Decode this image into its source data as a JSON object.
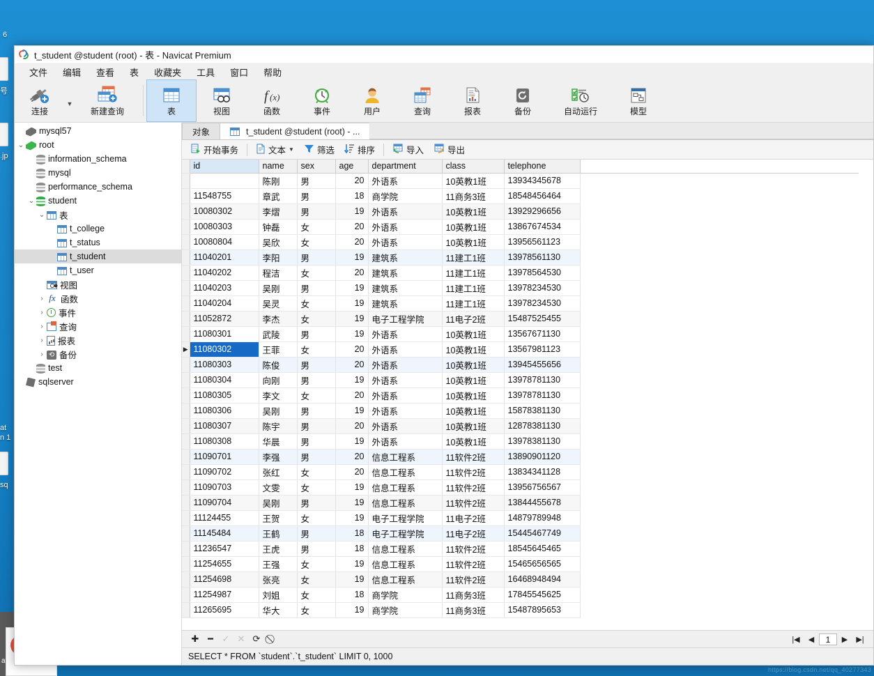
{
  "window": {
    "title": "t_student @student (root) - 表 - Navicat Premium",
    "logo_icon": "navicat-logo-icon"
  },
  "menubar": {
    "items": [
      {
        "label": "文件"
      },
      {
        "label": "编辑"
      },
      {
        "label": "查看"
      },
      {
        "label": "表"
      },
      {
        "label": "收藏夹"
      },
      {
        "label": "工具"
      },
      {
        "label": "窗口"
      },
      {
        "label": "帮助"
      }
    ]
  },
  "ribbon": {
    "items": [
      {
        "label": "连接",
        "icon": "connection-plug-icon",
        "active": false,
        "has_dropdown": true
      },
      {
        "label": "新建查询",
        "icon": "new-query-icon",
        "active": false
      },
      {
        "label": "表",
        "icon": "table-icon",
        "active": true
      },
      {
        "label": "视图",
        "icon": "view-icon",
        "active": false
      },
      {
        "label": "函数",
        "icon": "function-fx-icon",
        "active": false
      },
      {
        "label": "事件",
        "icon": "event-clock-icon",
        "active": false
      },
      {
        "label": "用户",
        "icon": "user-icon",
        "active": false
      },
      {
        "label": "查询",
        "icon": "query-icon",
        "active": false
      },
      {
        "label": "报表",
        "icon": "report-icon",
        "active": false
      },
      {
        "label": "备份",
        "icon": "backup-icon",
        "active": false
      },
      {
        "label": "自动运行",
        "icon": "automation-icon",
        "active": false
      },
      {
        "label": "模型",
        "icon": "model-icon",
        "active": false
      }
    ]
  },
  "sidebar": {
    "items": [
      {
        "label": "mysql57",
        "indent": 0,
        "twist": "",
        "icon": "connection-icon",
        "selected": false
      },
      {
        "label": "root",
        "indent": 0,
        "twist": "v",
        "icon": "connection-green-icon",
        "selected": false
      },
      {
        "label": "information_schema",
        "indent": 1,
        "twist": "",
        "icon": "database-icon",
        "selected": false
      },
      {
        "label": "mysql",
        "indent": 1,
        "twist": "",
        "icon": "database-icon",
        "selected": false
      },
      {
        "label": "performance_schema",
        "indent": 1,
        "twist": "",
        "icon": "database-icon",
        "selected": false
      },
      {
        "label": "student",
        "indent": 1,
        "twist": "v",
        "icon": "database-green-icon",
        "selected": false
      },
      {
        "label": "表",
        "indent": 2,
        "twist": "v",
        "icon": "table-folder-icon",
        "selected": false
      },
      {
        "label": "t_college",
        "indent": 3,
        "twist": "",
        "icon": "table-icon",
        "selected": false
      },
      {
        "label": "t_status",
        "indent": 3,
        "twist": "",
        "icon": "table-icon",
        "selected": false
      },
      {
        "label": "t_student",
        "indent": 3,
        "twist": "",
        "icon": "table-icon",
        "selected": true
      },
      {
        "label": "t_user",
        "indent": 3,
        "twist": "",
        "icon": "table-icon",
        "selected": false
      },
      {
        "label": "视图",
        "indent": 2,
        "twist": "",
        "icon": "view-icon",
        "selected": false
      },
      {
        "label": "函数",
        "indent": 2,
        "twist": ">",
        "icon": "function-fx-icon",
        "selected": false
      },
      {
        "label": "事件",
        "indent": 2,
        "twist": ">",
        "icon": "event-clock-icon",
        "selected": false
      },
      {
        "label": "查询",
        "indent": 2,
        "twist": ">",
        "icon": "query-icon",
        "selected": false
      },
      {
        "label": "报表",
        "indent": 2,
        "twist": ">",
        "icon": "report-icon",
        "selected": false
      },
      {
        "label": "备份",
        "indent": 2,
        "twist": ">",
        "icon": "backup-icon",
        "selected": false
      },
      {
        "label": "test",
        "indent": 1,
        "twist": "",
        "icon": "database-icon",
        "selected": false
      },
      {
        "label": "sqlserver",
        "indent": 0,
        "twist": "",
        "icon": "sqlserver-icon",
        "selected": false
      }
    ]
  },
  "tabs": [
    {
      "label": "对象",
      "active": false,
      "icon": ""
    },
    {
      "label": "t_student @student (root) - ...",
      "active": true,
      "icon": "table-icon"
    }
  ],
  "data_toolbar": {
    "items": [
      {
        "label": "开始事务",
        "icon": "transaction-icon",
        "dropdown": false
      },
      {
        "label": "文本",
        "icon": "text-icon",
        "dropdown": true
      },
      {
        "label": "筛选",
        "icon": "filter-icon",
        "dropdown": false
      },
      {
        "label": "排序",
        "icon": "sort-icon",
        "dropdown": false
      },
      {
        "label": "导入",
        "icon": "import-icon",
        "dropdown": false
      },
      {
        "label": "导出",
        "icon": "export-icon",
        "dropdown": false
      }
    ]
  },
  "grid": {
    "columns": [
      "id",
      "name",
      "sex",
      "age",
      "department",
      "class",
      "telephone"
    ],
    "selected_row_index": 12,
    "rows": [
      [
        "",
        "陈刚",
        "男",
        "20",
        "外语系",
        "10英教1班",
        "13934345678"
      ],
      [
        "11548755",
        "章武",
        "男",
        "18",
        "商学院",
        "11商务3班",
        "18548456464"
      ],
      [
        "10080302",
        "李熠",
        "男",
        "19",
        "外语系",
        "10英教1班",
        "13929296656"
      ],
      [
        "10080303",
        "钟磊",
        "女",
        "20",
        "外语系",
        "10英教1班",
        "13867674534"
      ],
      [
        "10080804",
        "吴欣",
        "女",
        "20",
        "外语系",
        "10英教1班",
        "13956561123"
      ],
      [
        "11040201",
        "李阳",
        "男",
        "19",
        "建筑系",
        "11建工1班",
        "13978561130"
      ],
      [
        "11040202",
        "程洁",
        "女",
        "20",
        "建筑系",
        "11建工1班",
        "13978564530"
      ],
      [
        "11040203",
        "吴刚",
        "男",
        "19",
        "建筑系",
        "11建工1班",
        "13978234530"
      ],
      [
        "11040204",
        "吴灵",
        "女",
        "19",
        "建筑系",
        "11建工1班",
        "13978234530"
      ],
      [
        "11052872",
        "李杰",
        "女",
        "19",
        "电子工程学院",
        "11电子2班",
        "15487525455"
      ],
      [
        "11080301",
        "武陵",
        "男",
        "19",
        "外语系",
        "10英教1班",
        "13567671130"
      ],
      [
        "11080302",
        "王菲",
        "女",
        "20",
        "外语系",
        "10英教1班",
        "13567981123"
      ],
      [
        "11080303",
        "陈俊",
        "男",
        "20",
        "外语系",
        "10英教1班",
        "13945455656"
      ],
      [
        "11080304",
        "向刚",
        "男",
        "19",
        "外语系",
        "10英教1班",
        "13978781130"
      ],
      [
        "11080305",
        "李文",
        "女",
        "20",
        "外语系",
        "10英教1班",
        "13978781130"
      ],
      [
        "11080306",
        "吴刚",
        "男",
        "19",
        "外语系",
        "10英教1班",
        "15878381130"
      ],
      [
        "11080307",
        "陈宇",
        "男",
        "20",
        "外语系",
        "10英教1班",
        "12878381130"
      ],
      [
        "11080308",
        "华晨",
        "男",
        "19",
        "外语系",
        "10英教1班",
        "13978381130"
      ],
      [
        "11090701",
        "李强",
        "男",
        "20",
        "信息工程系",
        "11软件2班",
        "13890901120"
      ],
      [
        "11090702",
        "张红",
        "女",
        "20",
        "信息工程系",
        "11软件2班",
        "13834341128"
      ],
      [
        "11090703",
        "文雯",
        "女",
        "19",
        "信息工程系",
        "11软件2班",
        "13956756567"
      ],
      [
        "11090704",
        "吴刚",
        "男",
        "19",
        "信息工程系",
        "11软件2班",
        "13844455678"
      ],
      [
        "11124455",
        "王贺",
        "女",
        "19",
        "电子工程学院",
        "11电子2班",
        "14879789948"
      ],
      [
        "11145484",
        "王鹤",
        "男",
        "18",
        "电子工程学院",
        "11电子2班",
        "15445467749"
      ],
      [
        "11236547",
        "王虎",
        "男",
        "18",
        "信息工程系",
        "11软件2班",
        "18545645465"
      ],
      [
        "11254655",
        "王强",
        "女",
        "19",
        "信息工程系",
        "11软件2班",
        "15465656565"
      ],
      [
        "11254698",
        "张亮",
        "女",
        "19",
        "信息工程系",
        "11软件2班",
        "16468948494"
      ],
      [
        "11254987",
        "刘姐",
        "女",
        "18",
        "商学院",
        "11商务3班",
        "17845545625"
      ],
      [
        "11265695",
        "华大",
        "女",
        "19",
        "商学院",
        "11商务3班",
        "15487895653"
      ]
    ]
  },
  "record_nav": {
    "buttons": [
      {
        "icon": "add-record-icon",
        "glyph": "✚",
        "disabled": false
      },
      {
        "icon": "delete-record-icon",
        "glyph": "━",
        "disabled": false
      },
      {
        "icon": "apply-change-icon",
        "glyph": "✓",
        "disabled": true
      },
      {
        "icon": "cancel-change-icon",
        "glyph": "✕",
        "disabled": true
      },
      {
        "icon": "refresh-icon",
        "glyph": "⟳",
        "disabled": false
      },
      {
        "icon": "stop-icon",
        "glyph": "⃠",
        "disabled": false
      }
    ],
    "pager": {
      "first_glyph": "|◀",
      "prev_glyph": "◀",
      "page_value": "1",
      "next_glyph": "▶",
      "last_glyph": "▶|"
    }
  },
  "statusbar": {
    "sql": "SELECT * FROM `student`.`t_student` LIMIT 0, 1000"
  },
  "desktop": {
    "icons": [
      {
        "label": "6"
      },
      {
        "label": "号"
      },
      {
        "label": ".jp"
      },
      {
        "label": "at"
      },
      {
        "label": "n 1"
      },
      {
        "label": "sq"
      }
    ],
    "taskbar_preview": {
      "label": "at",
      "app": "navicat",
      "caption": "avicat"
    },
    "watermark": "https://blog.csdn.net/qq_40277343"
  },
  "colors": {
    "accent": "#1669c4",
    "ribbon_active": "#cfe4f7",
    "desktop_blue": "#1580c4",
    "header_id": "#d9e8f7"
  }
}
